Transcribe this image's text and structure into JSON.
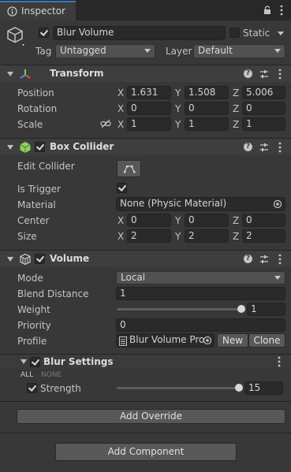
{
  "tab": {
    "title": "Inspector",
    "icon": "info-icon"
  },
  "object": {
    "name": "Blur Volume",
    "active": true,
    "static_label": "Static",
    "static": false,
    "tag_label": "Tag",
    "tag_value": "Untagged",
    "layer_label": "Layer",
    "layer_value": "Default"
  },
  "transform": {
    "title": "Transform",
    "rows": [
      {
        "label": "Position",
        "x": "1.631",
        "y": "1.508",
        "z": "5.006"
      },
      {
        "label": "Rotation",
        "x": "0",
        "y": "0",
        "z": "0"
      },
      {
        "label": "Scale",
        "x": "1",
        "y": "1",
        "z": "1"
      }
    ]
  },
  "box_collider": {
    "title": "Box Collider",
    "enabled": true,
    "edit_label": "Edit Collider",
    "is_trigger_label": "Is Trigger",
    "is_trigger": true,
    "material_label": "Material",
    "material_value": "None (Physic Material)",
    "center_label": "Center",
    "center": {
      "x": "0",
      "y": "0",
      "z": "0"
    },
    "size_label": "Size",
    "size": {
      "x": "2",
      "y": "2",
      "z": "2"
    }
  },
  "volume": {
    "title": "Volume",
    "enabled": true,
    "mode_label": "Mode",
    "mode_value": "Local",
    "blend_label": "Blend Distance",
    "blend_value": "1",
    "weight_label": "Weight",
    "weight_value": "1",
    "weight_fraction": 1.0,
    "priority_label": "Priority",
    "priority_value": "0",
    "profile_label": "Profile",
    "profile_value": "Blur Volume Pro",
    "new_label": "New",
    "clone_label": "Clone"
  },
  "blur_settings": {
    "title": "Blur Settings",
    "enabled": true,
    "all_label": "ALL",
    "none_label": "NONE",
    "strength_label": "Strength",
    "strength_enabled": true,
    "strength_value": "15",
    "strength_fraction": 1.0
  },
  "add_override_label": "Add Override",
  "add_component_label": "Add Component",
  "axes": {
    "x": "X",
    "y": "Y",
    "z": "Z"
  },
  "colors": {
    "background": "#383838",
    "header": "#3e3e3e",
    "field": "#2a2a2a",
    "accent": "#3a79bb"
  }
}
